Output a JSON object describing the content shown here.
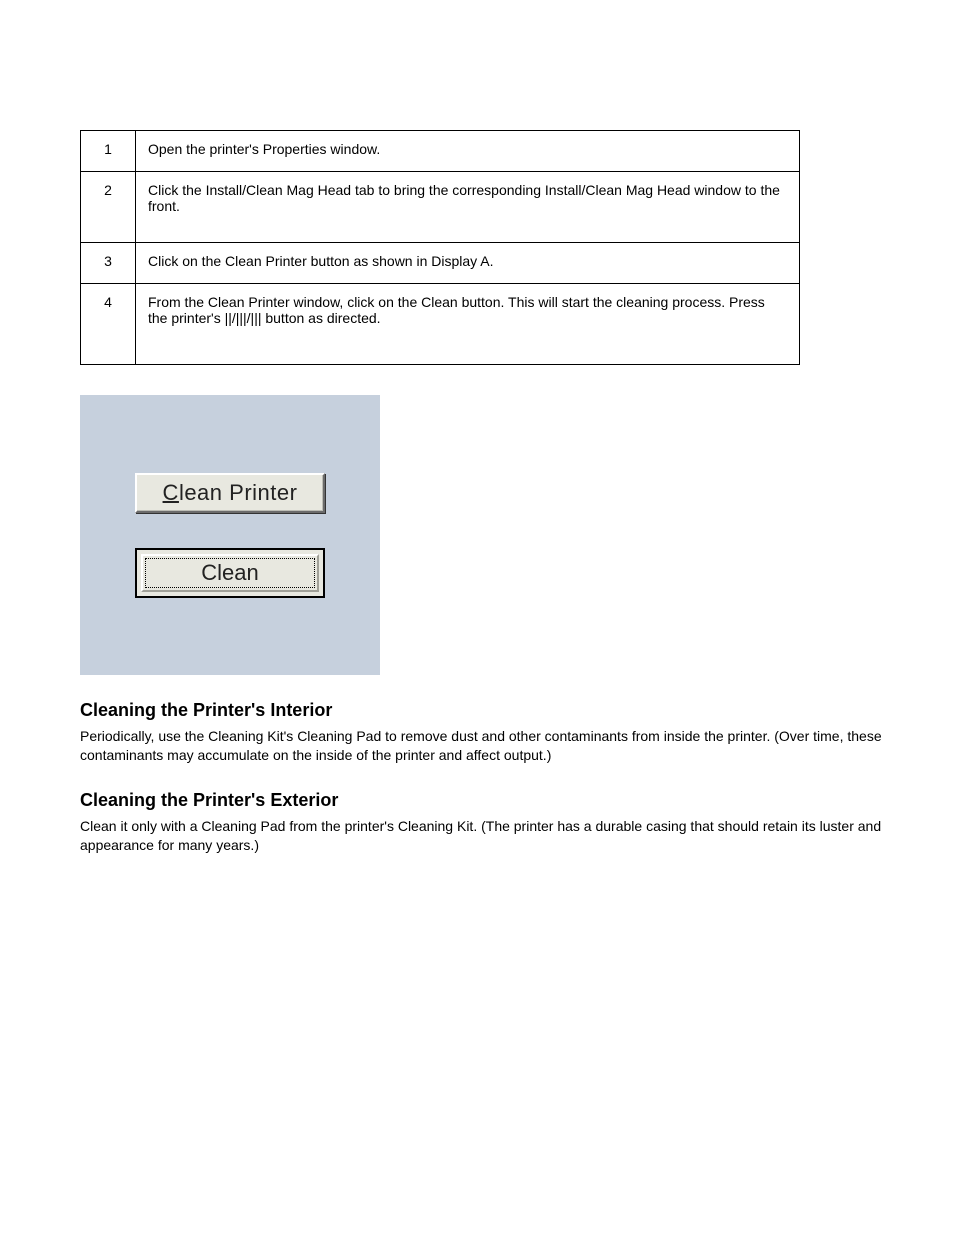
{
  "steps": [
    {
      "num": "1",
      "text": "Open the printer's Properties window."
    },
    {
      "num": "2",
      "text": "Click the Install/Clean Mag Head tab to bring the corresponding Install/Clean Mag Head window to the front."
    },
    {
      "num": "3",
      "text": "Click on the Clean Printer button as shown in Display A."
    },
    {
      "num": "4",
      "text": "From the Clean Printer window, click on the Clean button. This will start the cleaning process. Press the printer's ||/|||/||| button as directed."
    }
  ],
  "buttons": {
    "clean_printer_prefix": "C",
    "clean_printer_rest": "lean Printer",
    "clean": "Clean"
  },
  "sections": {
    "clean_inside": {
      "title": "Cleaning the Printer's Interior",
      "body": "Periodically, use the Cleaning Kit's Cleaning Pad to remove dust and other contaminants from inside the printer. (Over time, these contaminants may accumulate on the inside of the printer and affect output.)"
    },
    "clean_outside": {
      "title": "Cleaning the Printer's Exterior",
      "body": "Clean it only with a Cleaning Pad from the printer's Cleaning Kit. (The printer has a durable casing that should retain its luster and appearance for many years.)"
    }
  }
}
